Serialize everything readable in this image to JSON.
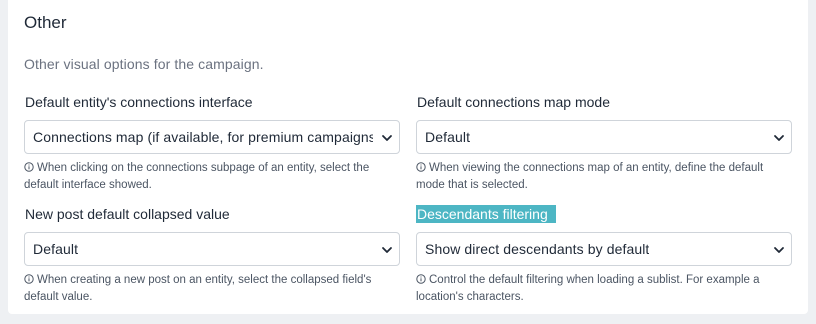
{
  "section": {
    "title": "Other",
    "description": "Other visual options for the campaign."
  },
  "fields": [
    {
      "label": "Default entity's connections interface",
      "value": "Connections map (if available, for premium campaigns)",
      "help": "When clicking on the connections subpage of an entity, select the default interface showed."
    },
    {
      "label": "Default connections map mode",
      "value": "Default",
      "help": "When viewing the connections map of an entity, define the default mode that is selected."
    },
    {
      "label": "New post default collapsed value",
      "value": "Default",
      "help": "When creating a new post on an entity, select the collapsed field's default value."
    },
    {
      "label": "Descendants filtering",
      "value": "Show direct descendants by default",
      "help": "Control the default filtering when loading a sublist. For example a location's characters."
    }
  ],
  "colors": {
    "highlight": "#4db6c4",
    "page_bg": "#eef0f3",
    "card_bg": "#ffffff"
  },
  "icons": {
    "help": "info-circle-icon",
    "dropdown": "chevron-down-icon"
  }
}
